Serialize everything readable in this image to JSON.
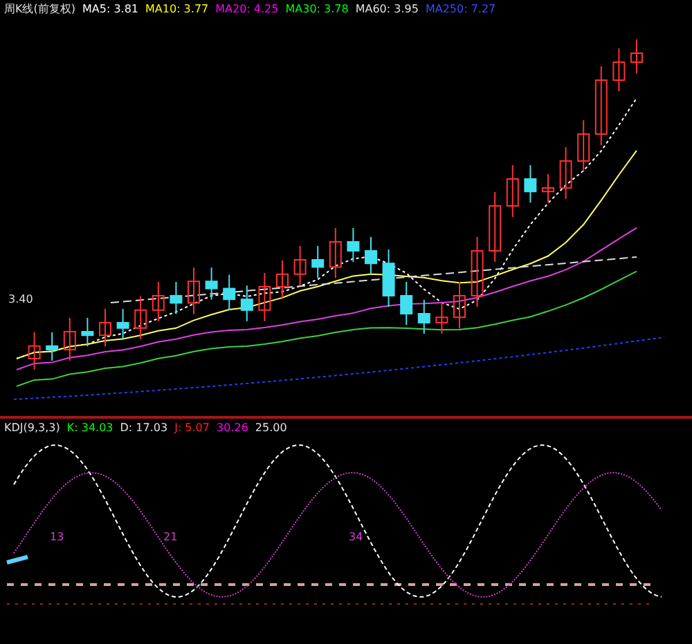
{
  "main_panel": {
    "legend": [
      {
        "text": "周K线(前复权)",
        "color": "#e0e0e0"
      },
      {
        "text": "MA5: 3.81",
        "color": "#ffffff"
      },
      {
        "text": "MA10: 3.77",
        "color": "#ffff00"
      },
      {
        "text": "MA20: 4.25",
        "color": "#ff00ff"
      },
      {
        "text": "MA30: 3.78",
        "color": "#00ff00"
      },
      {
        "text": "MA60: 3.95",
        "color": "#e0e0e0"
      },
      {
        "text": "MA250: 7.27",
        "color": "#3050ff"
      }
    ],
    "price_label": "3.40"
  },
  "indicator_panel": {
    "legend": [
      {
        "text": "KDJ(9,3,3)",
        "color": "#e0e0e0"
      },
      {
        "text": "K: 34.03",
        "color": "#00ff00"
      },
      {
        "text": "D: 17.03",
        "color": "#e0e0e0"
      },
      {
        "text": "J: 5.07",
        "color": "#ff2020"
      },
      {
        "text": "30.26",
        "color": "#ff00ff"
      },
      {
        "text": "25.00",
        "color": "#e0e0e0"
      }
    ],
    "cycle_labels": [
      "13",
      "21",
      "34"
    ]
  }
}
